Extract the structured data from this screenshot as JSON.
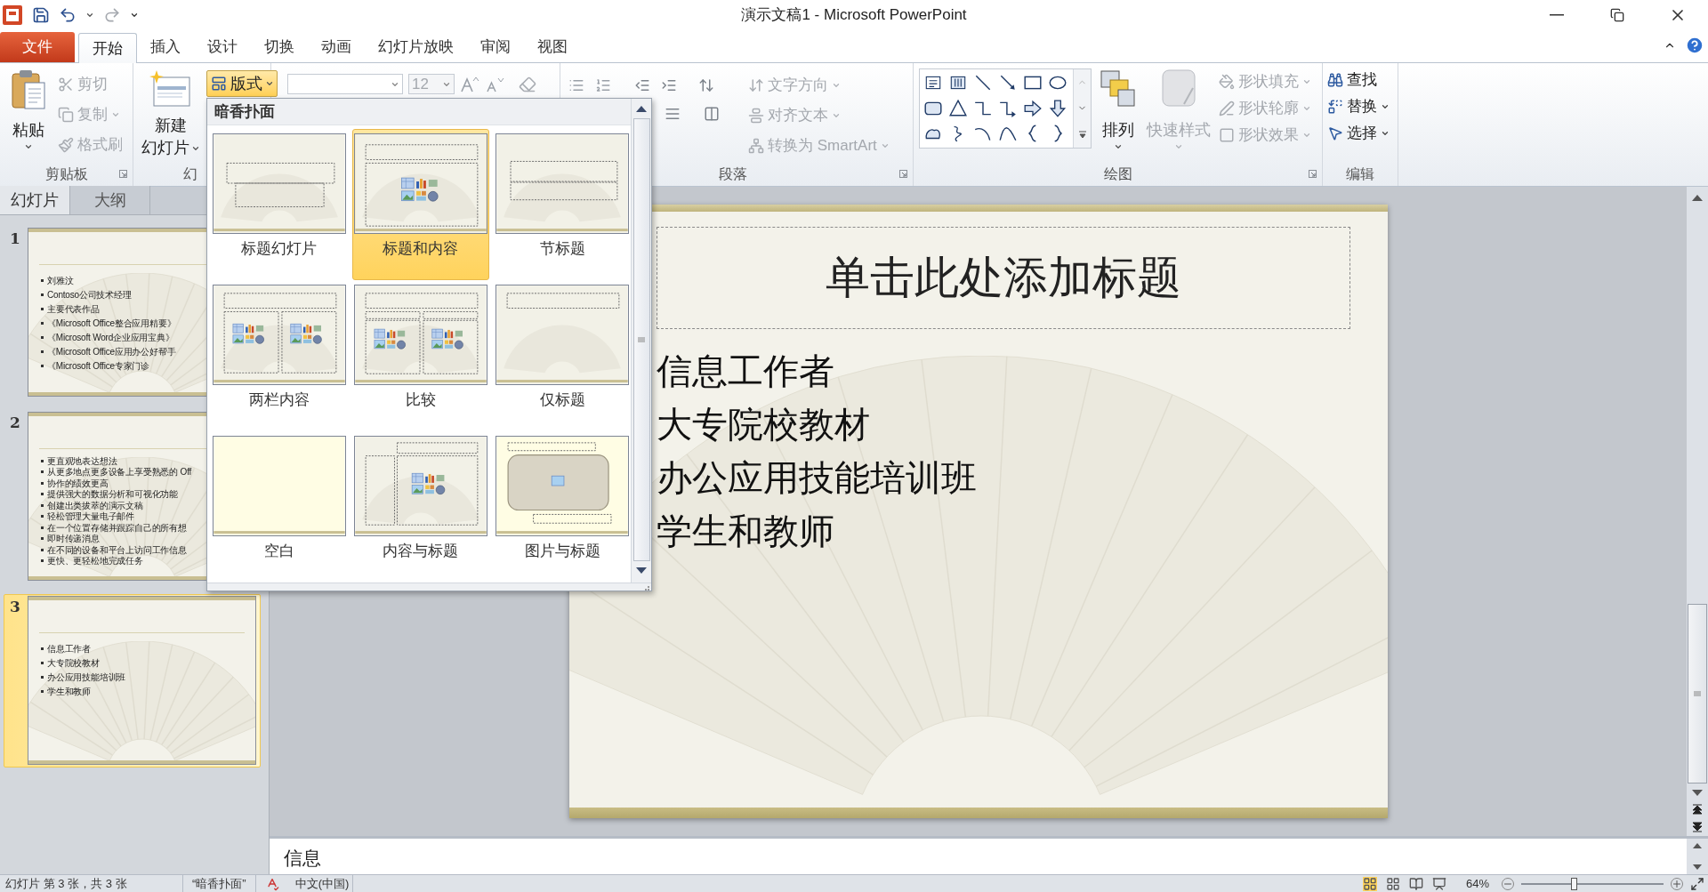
{
  "window": {
    "title": "演示文稿1 - Microsoft PowerPoint"
  },
  "tabs": [
    {
      "label": "文件",
      "kind": "file",
      "selected": false
    },
    {
      "label": "开始",
      "kind": "tab",
      "selected": true
    },
    {
      "label": "插入",
      "kind": "tab",
      "selected": false
    },
    {
      "label": "设计",
      "kind": "tab",
      "selected": false
    },
    {
      "label": "切换",
      "kind": "tab",
      "selected": false
    },
    {
      "label": "动画",
      "kind": "tab",
      "selected": false
    },
    {
      "label": "幻灯片放映",
      "kind": "tab",
      "selected": false
    },
    {
      "label": "审阅",
      "kind": "tab",
      "selected": false
    },
    {
      "label": "视图",
      "kind": "tab",
      "selected": false
    }
  ],
  "ribbon": {
    "clipboard": {
      "label": "剪贴板",
      "paste": "粘贴",
      "items": [
        {
          "label": "剪切",
          "kind": "cut",
          "disabled": true
        },
        {
          "label": "复制",
          "kind": "copy",
          "disabled": true
        },
        {
          "label": "格式刷",
          "kind": "format_painter",
          "disabled": true
        }
      ]
    },
    "slides": {
      "label": "幻",
      "new_slide": [
        "新建",
        "幻灯片"
      ],
      "layout": {
        "label": "版式",
        "expanded": true
      }
    },
    "font": {
      "size": {
        "value": "12",
        "disabled": true
      }
    },
    "paragraph": {
      "label": "段落",
      "items": [
        {
          "label": "文字方向",
          "kind": "text_direction",
          "disabled": true
        },
        {
          "label": "对齐文本",
          "kind": "align_text",
          "disabled": true
        },
        {
          "label": "转换为 SmartArt",
          "kind": "smartart",
          "disabled": true
        }
      ]
    },
    "drawing": {
      "label": "绘图",
      "arrange": "排列",
      "quick_styles": {
        "label": "快速样式",
        "disabled": true
      },
      "items": [
        {
          "label": "形状填充",
          "kind": "fill",
          "disabled": true
        },
        {
          "label": "形状轮廓",
          "kind": "outline",
          "disabled": true
        },
        {
          "label": "形状效果",
          "kind": "effects",
          "disabled": true
        }
      ]
    },
    "editing": {
      "label": "编辑",
      "items": [
        {
          "label": "查找",
          "kind": "find",
          "dropdown": false
        },
        {
          "label": "替换",
          "kind": "replace",
          "dropdown": true
        },
        {
          "label": "选择",
          "kind": "select",
          "dropdown": true
        }
      ]
    }
  },
  "panel_tabs": [
    {
      "label": "幻灯片",
      "selected": true
    },
    {
      "label": "大纲",
      "selected": false
    }
  ],
  "slides": [
    {
      "number": "1",
      "selected": false,
      "bullets": [
        "刘雅汶",
        "Contoso公司技术经理",
        "主要代表作品",
        "《Microsoft Office整合应用精要》",
        "《Microsoft Word企业应用宝典》",
        "《Microsoft Office应用办公好帮手",
        "《Microsoft Office专家门诊"
      ]
    },
    {
      "number": "2",
      "selected": false,
      "bullets": [
        "更直观地表达想法",
        "从更多地点更多设备上享受熟悉的 Off",
        "协作的绩效更高",
        "提供强大的数据分析和可视化功能",
        "创建出类拔萃的演示文稿",
        "轻松管理大量电子邮件",
        "在一个位置存储并跟踪自己的所有想",
        "即时传递消息",
        "在不同的设备和平台上访问工作信息",
        "更快、更轻松地完成任务"
      ]
    },
    {
      "number": "3",
      "selected": true,
      "bullets": [
        "信息工作者",
        "大专院校教材",
        "办公应用技能培训班",
        "学生和教师"
      ]
    }
  ],
  "layout_menu": {
    "theme": "暗香扑面",
    "layouts": [
      {
        "name": "标题幻灯片",
        "kind": "title",
        "selected": false
      },
      {
        "name": "标题和内容",
        "kind": "title_content",
        "selected": true
      },
      {
        "name": "节标题",
        "kind": "section",
        "selected": false
      },
      {
        "name": "两栏内容",
        "kind": "two_content",
        "selected": false
      },
      {
        "name": "比较",
        "kind": "comparison",
        "selected": false
      },
      {
        "name": "仅标题",
        "kind": "title_only",
        "selected": false
      },
      {
        "name": "空白",
        "kind": "blank",
        "selected": false
      },
      {
        "name": "内容与标题",
        "kind": "content_caption",
        "selected": false
      },
      {
        "name": "图片与标题",
        "kind": "picture_caption",
        "selected": false
      }
    ]
  },
  "slide": {
    "title": "单击此处添加标题",
    "bullets": [
      "信息工作者",
      "大专院校教材",
      "办公应用技能培训班",
      "学生和教师"
    ]
  },
  "notes": {
    "text": "信息"
  },
  "status_bar": {
    "slide": "幻灯片 第 3 张，共 3 张",
    "theme": "“暗香扑面”",
    "language": "中文(中国)",
    "zoom": "64%",
    "zoom_slider": {
      "level": 0.37
    }
  }
}
